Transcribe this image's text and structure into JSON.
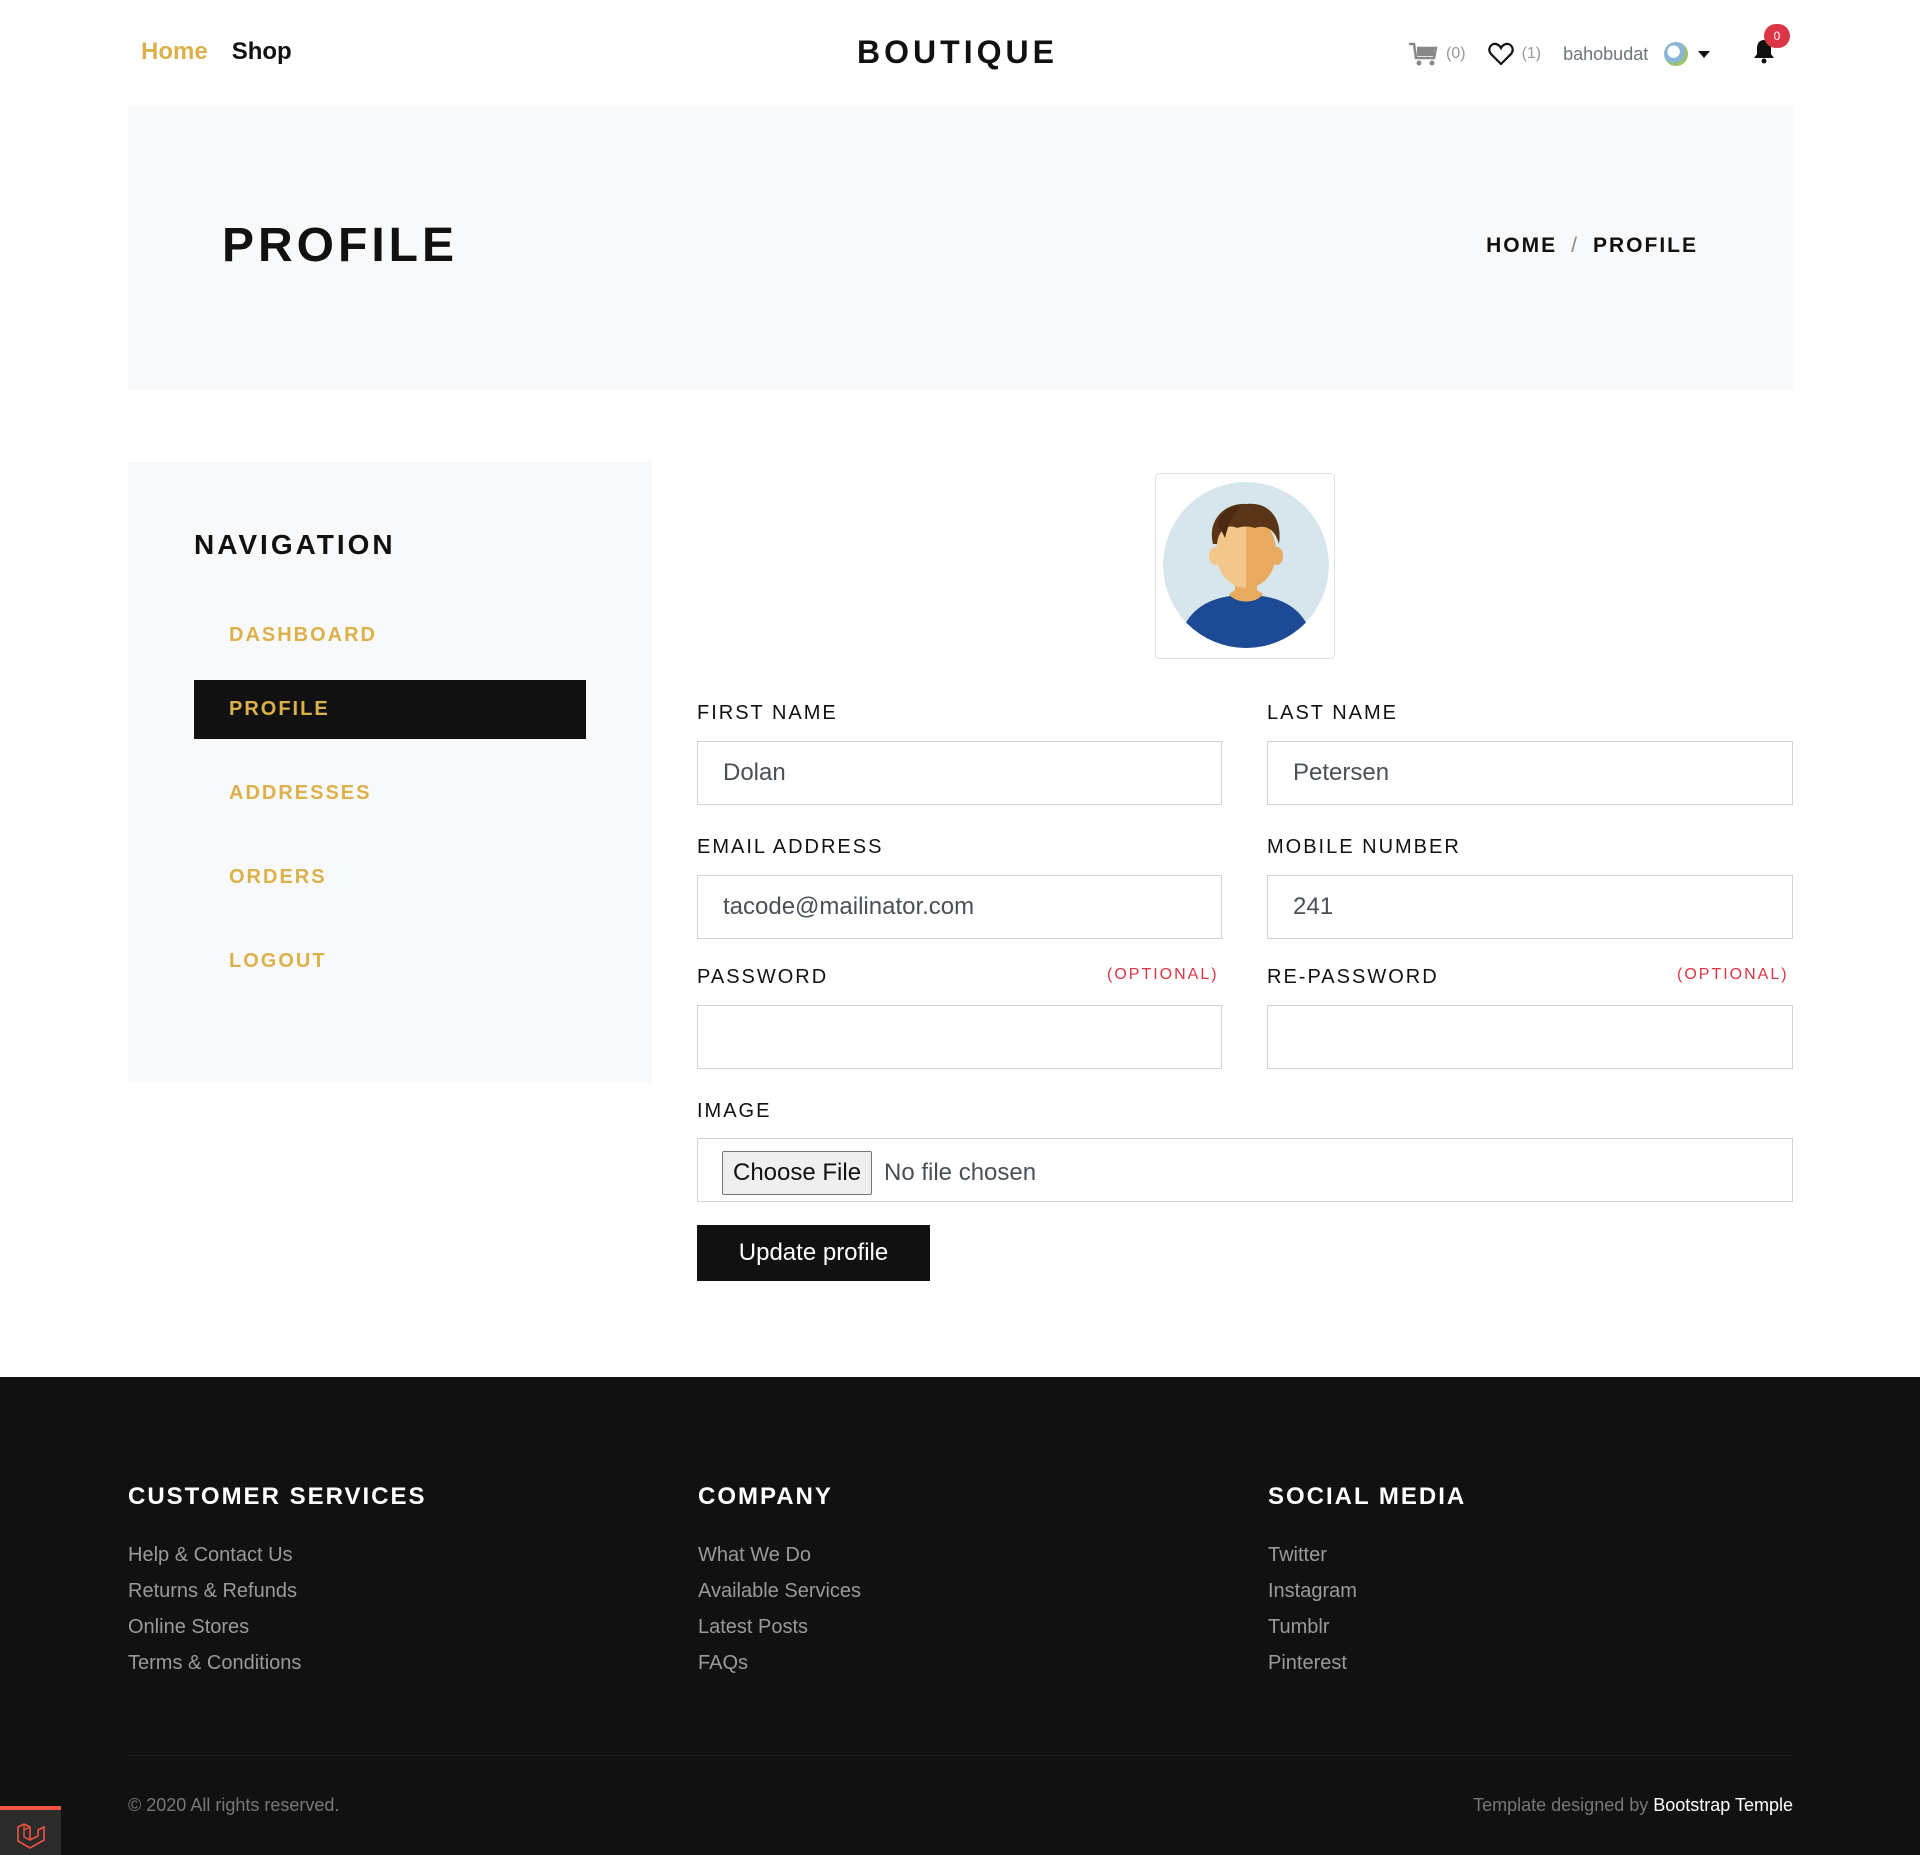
{
  "header": {
    "nav": {
      "home": "Home",
      "shop": "Shop"
    },
    "brand": "BOUTIQUE",
    "cart_count": "(0)",
    "wishlist_count": "(1)",
    "username": "bahobudat",
    "notification_count": "0",
    "accent_color": "#dcb14a"
  },
  "hero": {
    "title": "PROFILE",
    "breadcrumb": {
      "home": "HOME",
      "separator": "/",
      "current": "PROFILE"
    }
  },
  "sidebar": {
    "title": "NAVIGATION",
    "items": [
      {
        "label": "DASHBOARD"
      },
      {
        "label": "PROFILE"
      },
      {
        "label": "ADDRESSES"
      },
      {
        "label": "ORDERS"
      },
      {
        "label": "LOGOUT"
      }
    ],
    "active": "PROFILE"
  },
  "form": {
    "first_name": {
      "label": "FIRST NAME",
      "value": "Dolan"
    },
    "last_name": {
      "label": "LAST NAME",
      "value": "Petersen"
    },
    "email": {
      "label": "EMAIL ADDRESS",
      "value": "tacode@mailinator.com"
    },
    "mobile": {
      "label": "MOBILE NUMBER",
      "value": "241"
    },
    "password": {
      "label": "PASSWORD",
      "hint": "(OPTIONAL)",
      "value": ""
    },
    "re_password": {
      "label": "RE-PASSWORD",
      "hint": "(OPTIONAL)",
      "value": ""
    },
    "image": {
      "label": "IMAGE",
      "button": "Choose File",
      "status": "No file chosen"
    },
    "submit": "Update profile"
  },
  "footer": {
    "columns": [
      {
        "title": "CUSTOMER SERVICES",
        "links": [
          "Help & Contact Us",
          "Returns & Refunds",
          "Online Stores",
          "Terms & Conditions"
        ]
      },
      {
        "title": "COMPANY",
        "links": [
          "What We Do",
          "Available Services",
          "Latest Posts",
          "FAQs"
        ]
      },
      {
        "title": "SOCIAL MEDIA",
        "links": [
          "Twitter",
          "Instagram",
          "Tumblr",
          "Pinterest"
        ]
      }
    ],
    "copyright": "© 2020 All rights reserved.",
    "designed_prefix": "Template designed by ",
    "designed_link": "Bootstrap Temple"
  }
}
